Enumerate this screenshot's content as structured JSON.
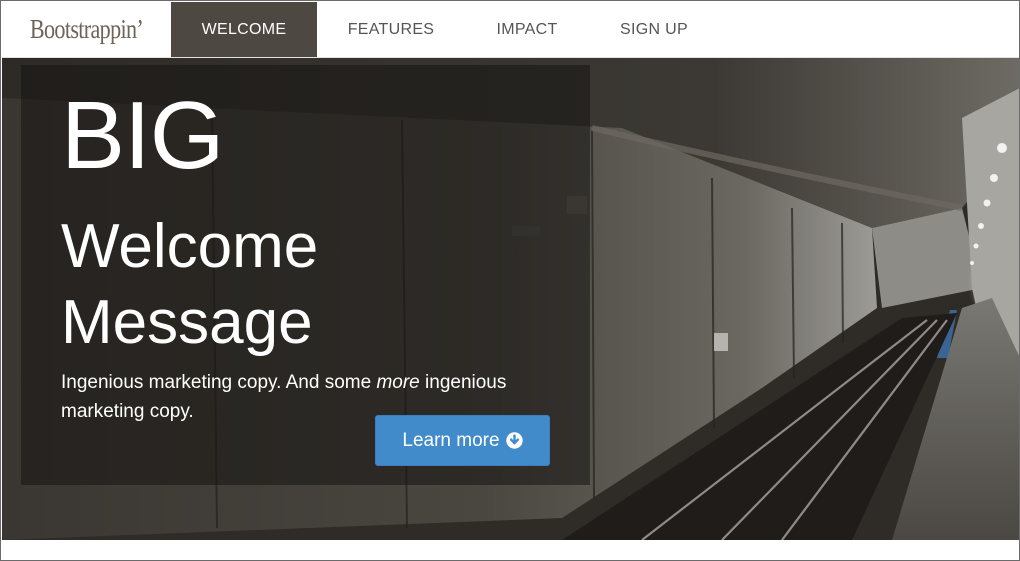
{
  "brand": {
    "name": "Bootstrappin’"
  },
  "nav": {
    "items": [
      {
        "label": "WELCOME",
        "active": true
      },
      {
        "label": "FEATURES",
        "active": false
      },
      {
        "label": "IMPACT",
        "active": false
      },
      {
        "label": "SIGN UP",
        "active": false
      }
    ]
  },
  "hero": {
    "big": "BIG",
    "title_line1": "Welcome",
    "title_line2": "Message",
    "copy_before": "Ingenious marketing copy. And some ",
    "copy_emphasis": "more",
    "copy_after": " ingenious marketing copy.",
    "button_label": "Learn more",
    "button_icon": "arrow-circle-down-icon",
    "background_description_icon": "subway-tunnel-photo"
  },
  "colors": {
    "nav_active_bg": "#4d4842",
    "brand_text": "#6f6359",
    "button_bg": "#428bca",
    "panel_overlay": "rgba(22,20,18,0.55)"
  }
}
